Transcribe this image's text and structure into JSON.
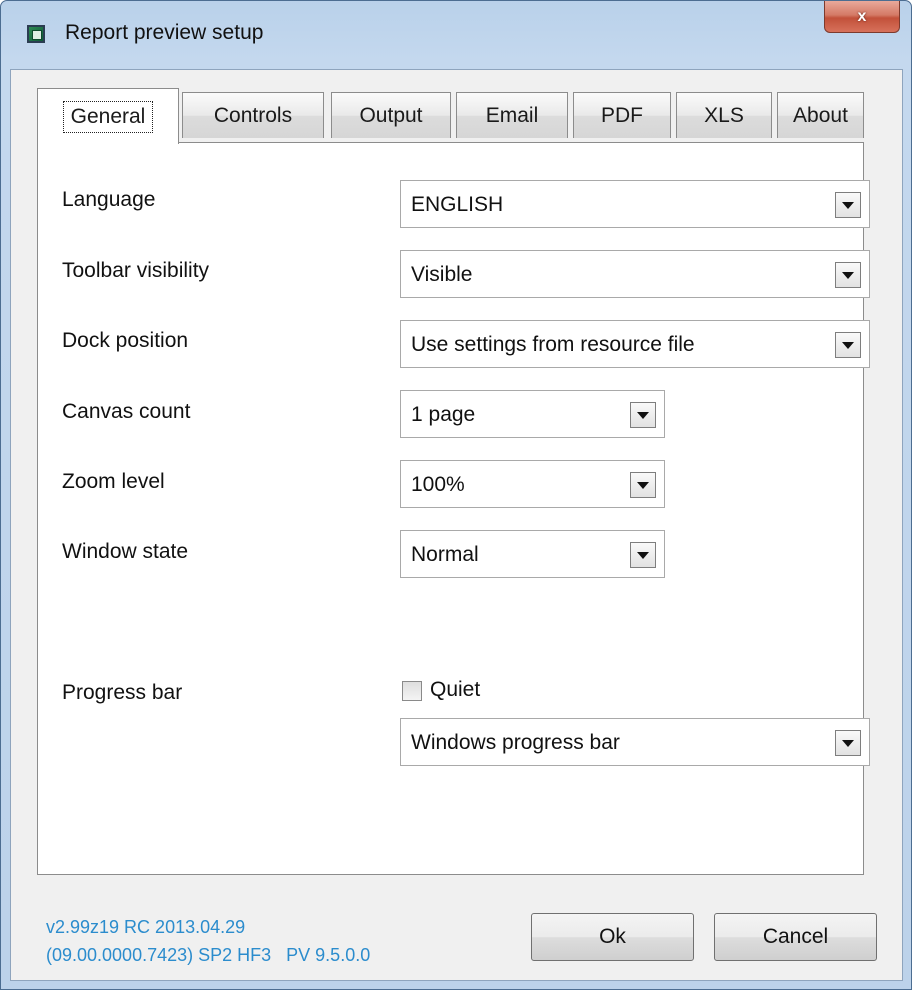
{
  "window": {
    "title": "Report preview setup",
    "close_glyph": "x"
  },
  "tabs": [
    {
      "label": "General",
      "active": true
    },
    {
      "label": "Controls",
      "active": false
    },
    {
      "label": "Output",
      "active": false
    },
    {
      "label": "Email",
      "active": false
    },
    {
      "label": "PDF",
      "active": false
    },
    {
      "label": "XLS",
      "active": false
    },
    {
      "label": "About",
      "active": false
    }
  ],
  "general": {
    "language": {
      "label": "Language",
      "value": "ENGLISH"
    },
    "toolbar_visibility": {
      "label": "Toolbar visibility",
      "value": "Visible"
    },
    "dock_position": {
      "label": "Dock position",
      "value": "Use settings from resource file"
    },
    "canvas_count": {
      "label": "Canvas count",
      "value": "1 page"
    },
    "zoom_level": {
      "label": "Zoom level",
      "value": "100%"
    },
    "window_state": {
      "label": "Window state",
      "value": "Normal"
    },
    "progress_bar": {
      "label": "Progress bar",
      "quiet_label": "Quiet",
      "quiet_checked": false,
      "value": "Windows progress bar"
    }
  },
  "footer": {
    "version_line1": "v2.99z19 RC 2013.04.29",
    "version_line2": "(09.00.0000.7423) SP2 HF3   PV 9.5.0.0",
    "ok_label": "Ok",
    "cancel_label": "Cancel"
  },
  "colors": {
    "version_text": "#2b8ccd",
    "close_button": "#c2513a",
    "frame": "#b9d1ea"
  }
}
